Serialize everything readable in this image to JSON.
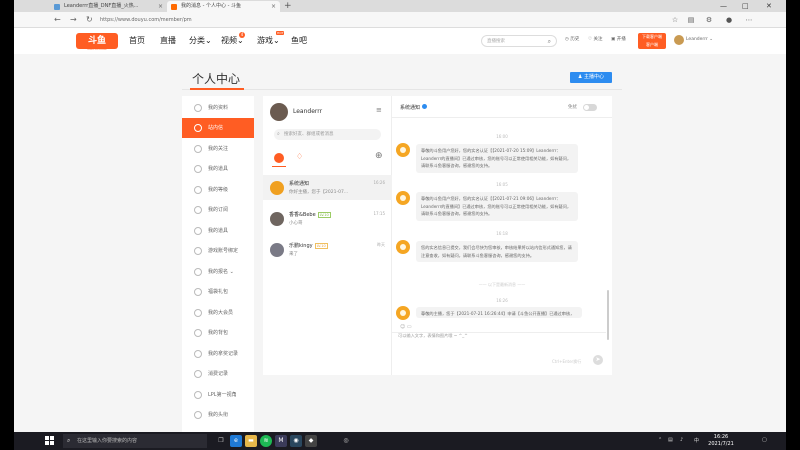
{
  "browser": {
    "tabs": [
      {
        "title": "Leanderrr直播_DNF直播_火热..."
      },
      {
        "title": "我的消息 - 个人中心 - 斗鱼"
      }
    ],
    "url": "https://www.douyu.com/member/pm"
  },
  "header": {
    "logo_text": "斗鱼",
    "logo_sub": "DOUYU.COM",
    "nav": [
      "首页",
      "直播",
      "分类",
      "视频",
      "游戏",
      "鱼吧"
    ],
    "video_badge": "4",
    "game_badge": "HOT",
    "search_placeholder": "直播搜索",
    "history": "历史",
    "follow": "关注",
    "open": "开播",
    "client_top": "下载客户端",
    "client_bottom": "客户端",
    "username": "Leanderrr"
  },
  "page": {
    "title": "个人中心",
    "anchor_center": "主播中心"
  },
  "sidebar": {
    "items": [
      {
        "label": "我的资料"
      },
      {
        "label": "站内信"
      },
      {
        "label": "我的关注"
      },
      {
        "label": "我的道具"
      },
      {
        "label": "我的等级"
      },
      {
        "label": "我的订阅"
      },
      {
        "label": "我的道具"
      },
      {
        "label": "游戏账号绑定"
      },
      {
        "label": "我的报名"
      },
      {
        "label": "福袋礼包"
      },
      {
        "label": "我的大会员"
      },
      {
        "label": "我的背包"
      },
      {
        "label": "我的拿奖记录"
      },
      {
        "label": "消费记录"
      },
      {
        "label": "LPL第一视角"
      },
      {
        "label": "我的头衔"
      }
    ]
  },
  "chat": {
    "me": "Leanderrr",
    "search_placeholder": "搜索好友、群组或者消息",
    "contacts": [
      {
        "name": "系统通知",
        "preview": "你好主播，您于【2021-07...",
        "time": "16:26",
        "level": ""
      },
      {
        "name": "香香&Bebe",
        "preview": "小心哥",
        "time": "17:15",
        "level": "LV.10"
      },
      {
        "name": "乐鹏kingy",
        "preview": "来了",
        "time": "昨天",
        "level": "LV.10"
      }
    ],
    "window_title": "系统通知",
    "mute_label": "免扰",
    "messages": [
      {
        "time": "16:00",
        "text": "尊敬的斗鱼用户您好，您的实名认证【【2021-07-20 15:09】Leanderrr：Leanderrr的直播间】已通过审核，您的账号可以正常使用相关功能，如有疑问，请联系斗鱼客服咨询，感谢您的支持。"
      },
      {
        "time": "16:05",
        "text": "尊敬的斗鱼用户您好，您的实名认证【【2021-07-21 09:06】Leanderrr：Leanderrr的直播间】已通过审核，您的账号可以正常使用相关功能，如有疑问，请联系斗鱼客服咨询，感谢您的支持。"
      },
      {
        "time": "16:18",
        "text": "您的实名信息已提交，我们会尽快为您审核，审核结果将以站内信形式通知您，请注意查收，如有疑问，请联系斗鱼客服咨询，感谢您的支持。"
      },
      {
        "time": "16:26",
        "text": "尊敬的主播，您于【2021-07-21 16:26:44】申请【斗鱼公开直播】已通过审核，请遵守直播规范。"
      }
    ],
    "separator": "—— 以下是最新消息 ——",
    "input_placeholder": "可以输入文字，表情和图片哦 ~ ^_^",
    "send_hint": "Ctrl+Enter换行"
  },
  "taskbar": {
    "search_placeholder": "在这里输入你要搜索的内容",
    "time": "16:26",
    "date": "2021/7/21",
    "ime": "中"
  }
}
